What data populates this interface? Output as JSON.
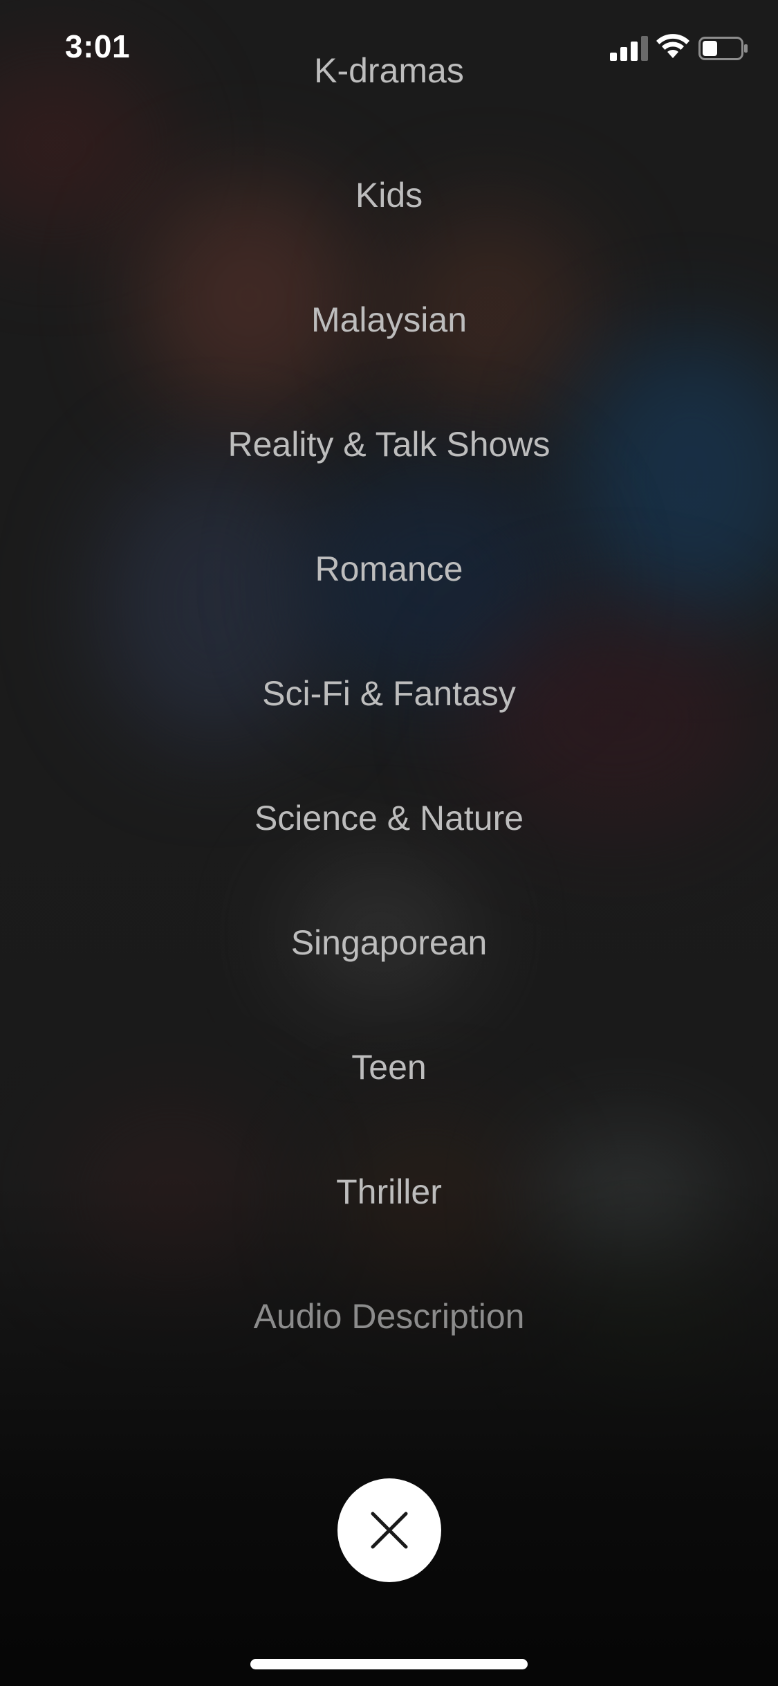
{
  "status_bar": {
    "time": "3:01",
    "signal_icon": "cellular-signal-icon",
    "wifi_icon": "wifi-icon",
    "battery_icon": "battery-icon",
    "battery_level": 0.4
  },
  "genre_menu": {
    "items": [
      {
        "label": "K-dramas"
      },
      {
        "label": "Kids"
      },
      {
        "label": "Malaysian"
      },
      {
        "label": "Reality & Talk Shows"
      },
      {
        "label": "Romance"
      },
      {
        "label": "Sci-Fi & Fantasy"
      },
      {
        "label": "Science & Nature"
      },
      {
        "label": "Singaporean"
      },
      {
        "label": "Teen"
      },
      {
        "label": "Thriller"
      },
      {
        "label": "Audio Description"
      }
    ]
  },
  "close_button": {
    "icon": "close-icon"
  },
  "colors": {
    "item_text": "#bdbdbd",
    "item_text_dim": "#8c8c8c",
    "close_button_bg": "#ffffff",
    "close_icon": "#1a1a1a"
  }
}
